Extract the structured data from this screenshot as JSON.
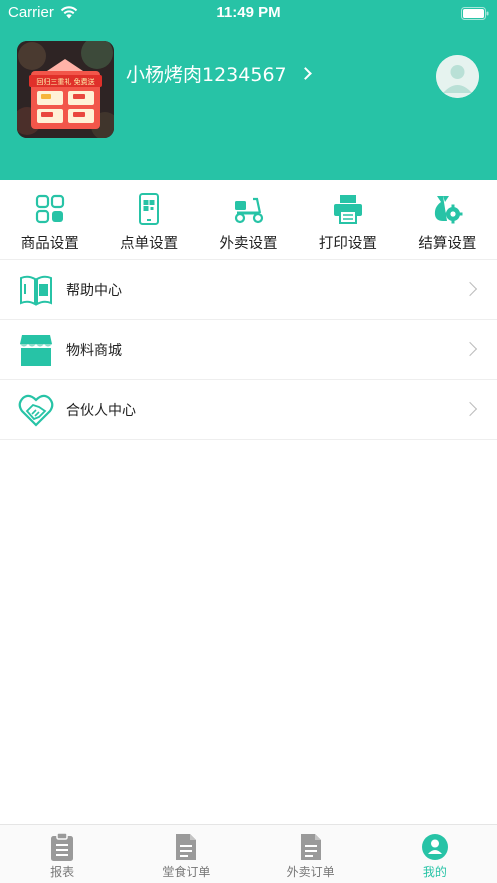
{
  "status_bar": {
    "carrier": "Carrier",
    "time": "11:49 PM"
  },
  "profile": {
    "store_name": "小杨烤肉1234567",
    "thumbnail_banner_text": "回归三重礼 免费送"
  },
  "shortcuts": [
    {
      "label": "商品设置",
      "icon": "grid-apps-icon"
    },
    {
      "label": "点单设置",
      "icon": "qr-phone-icon"
    },
    {
      "label": "外卖设置",
      "icon": "scooter-icon"
    },
    {
      "label": "打印设置",
      "icon": "printer-icon"
    },
    {
      "label": "结算设置",
      "icon": "settlement-gear-icon"
    }
  ],
  "menu": [
    {
      "label": "帮助中心",
      "icon": "book-icon"
    },
    {
      "label": "物料商城",
      "icon": "store-icon"
    },
    {
      "label": "合伙人中心",
      "icon": "handshake-icon"
    }
  ],
  "tabbar": [
    {
      "label": "报表",
      "icon": "clipboard-icon",
      "active": false
    },
    {
      "label": "堂食订单",
      "icon": "document-icon",
      "active": false
    },
    {
      "label": "外卖订单",
      "icon": "document-icon",
      "active": false
    },
    {
      "label": "我的",
      "icon": "user-circle-icon",
      "active": true
    }
  ],
  "colors": {
    "accent": "#27c3a6",
    "tab_inactive": "#777777",
    "divider": "#eeeeee"
  }
}
